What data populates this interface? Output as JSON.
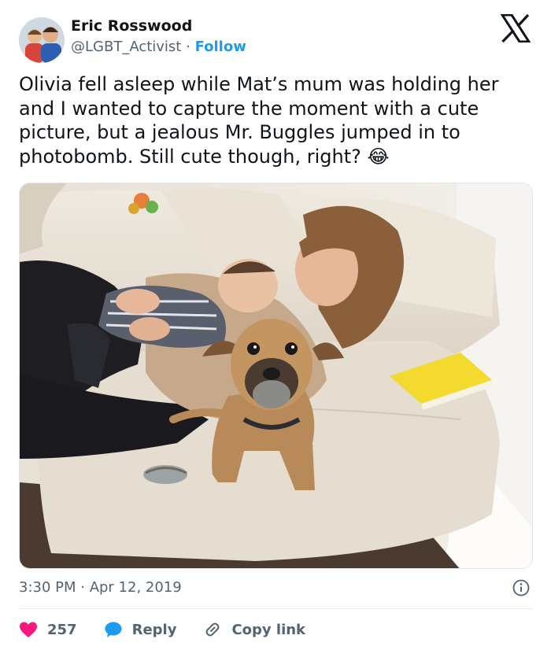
{
  "author": {
    "name": "Eric Rosswood",
    "handle": "@LGBT_Activist",
    "separator": "·",
    "follow_label": "Follow"
  },
  "tweet": {
    "text": "Olivia fell asleep while Mat’s mum was holding her and I wanted to capture the moment with a cute picture, but a jealous Mr. Buggles jumped in to photobomb. Still cute though, right? 😂",
    "timestamp": "3:30 PM · Apr 12, 2019"
  },
  "actions": {
    "like_count": "257",
    "reply_label": "Reply",
    "copy_link_label": "Copy link"
  },
  "icons": {
    "logo": "x-logo-icon",
    "info": "info-icon",
    "like": "heart-icon",
    "reply": "reply-bubble-icon",
    "copy": "link-icon"
  },
  "colors": {
    "follow": "#1d9bf0",
    "like": "#f91880",
    "reply": "#1d9bf0",
    "muted": "#536471"
  }
}
